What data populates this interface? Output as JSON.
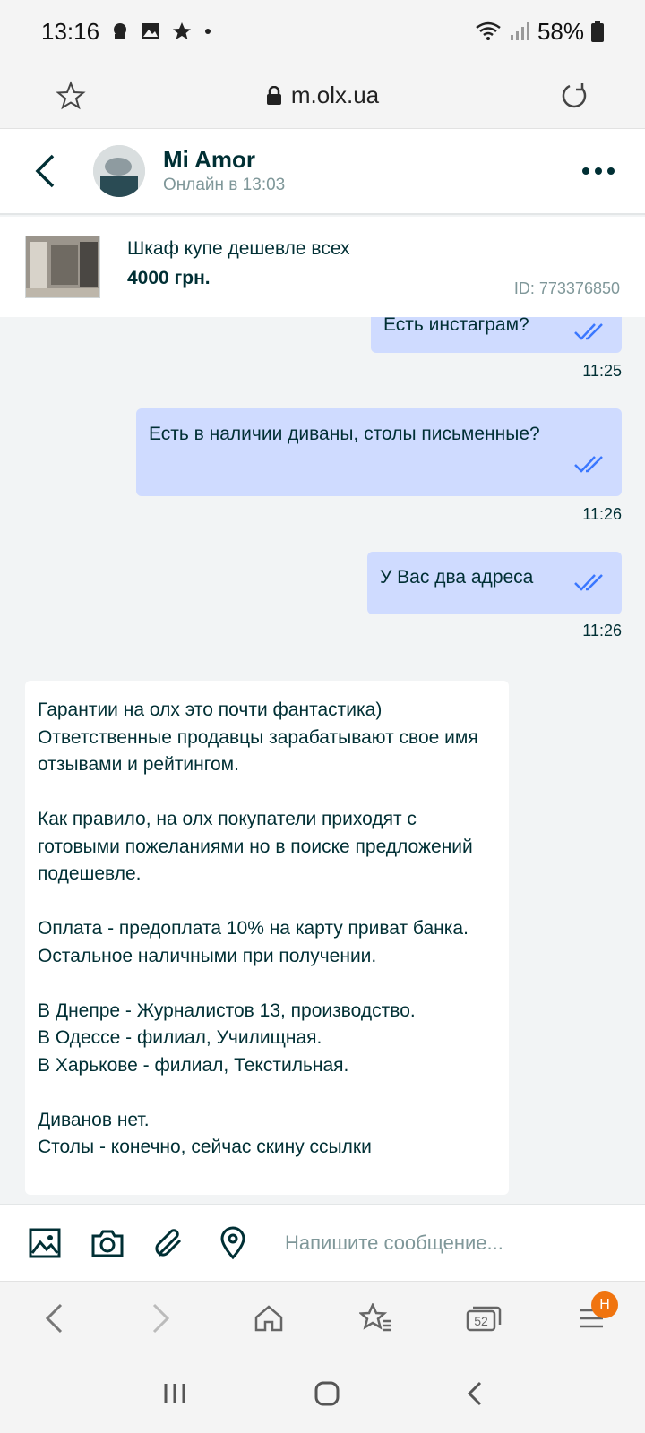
{
  "status_bar": {
    "time": "13:16",
    "battery": "58%"
  },
  "browser": {
    "url": "m.olx.ua",
    "tabs_count": "52",
    "menu_badge": "H"
  },
  "chat_header": {
    "name": "Mi Amor",
    "status": "Онлайн в 13:03"
  },
  "listing": {
    "title": "Шкаф купе дешевле всех",
    "price": "4000 грн.",
    "id": "ID: 773376850"
  },
  "messages": [
    {
      "direction": "out",
      "text": "Есть инстаграм?",
      "time": "11:25"
    },
    {
      "direction": "out",
      "text": "Есть в наличии диваны, столы письменные?",
      "time": "11:26"
    },
    {
      "direction": "out",
      "text": "У Вас два адреса",
      "time": "11:26"
    },
    {
      "direction": "in",
      "text": "Гарантии на олх это почти фантастика)\nОтветственные продавцы зарабатывают свое имя отзывами и рейтингом.\n\nКак правило, на олх покупатели приходят с готовыми пожеланиями но в поиске предложений подешевле.\n\nОплата - предоплата 10% на карту приват банка.\nОстальное наличными при получении.\n\nВ Днепре - Журналистов 13, производство.\nВ Одессе - филиал, Училищная.\nВ Харькове - филиал, Текстильная.\n\nДиванов нет.\nСтолы - конечно, сейчас скину ссылки"
    }
  ],
  "composer": {
    "placeholder": "Напишите сообщение..."
  },
  "colors": {
    "outgoing_bubble": "#cfdbff",
    "incoming_bubble": "#ffffff",
    "accent": "#3a77ff",
    "badge": "#f0740f"
  },
  "icons": [
    "star-icon",
    "lock-icon",
    "reload-icon",
    "back-arrow-icon",
    "more-icon",
    "image-icon",
    "camera-icon",
    "attach-icon",
    "location-icon",
    "home-icon",
    "bookmarks-icon",
    "tabs-icon",
    "menu-icon"
  ]
}
